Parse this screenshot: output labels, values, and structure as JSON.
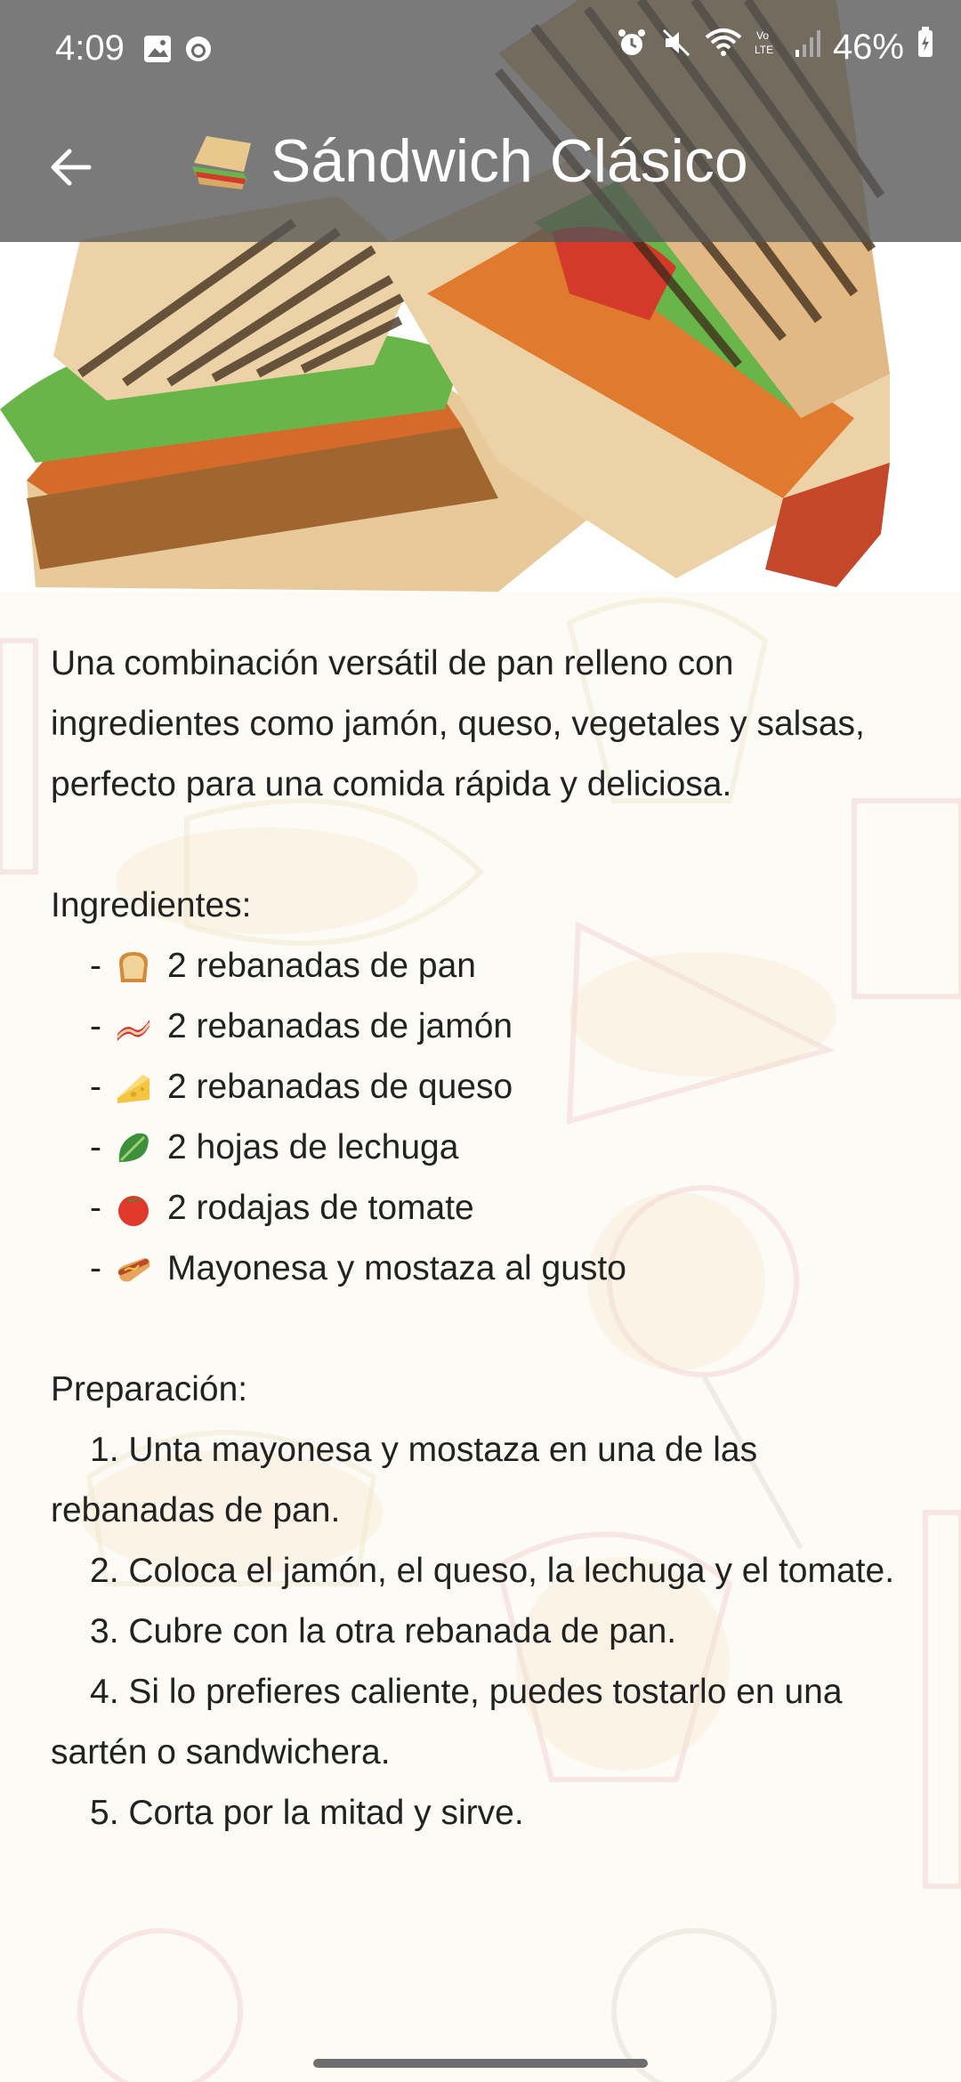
{
  "status_bar": {
    "time": "4:09",
    "battery": "46%",
    "icons": [
      "gallery-icon",
      "sync-icon",
      "alarm-icon",
      "mute-icon",
      "wifi-icon",
      "volte-icon",
      "signal-icon",
      "battery-icon"
    ]
  },
  "toolbar": {
    "back_icon": "arrow-left-icon",
    "title": "Sándwich Clásico",
    "title_icon": "sandwich-icon"
  },
  "colors": {
    "appbar": "#555555",
    "text": "#222222",
    "background": "#fdfbf6"
  },
  "recipe": {
    "description": "Una combinación versátil de pan relleno con ingredientes como jamón, queso, vegetales y salsas, perfecto para una comida rápida y deliciosa.",
    "ingredients_title": "Ingredientes:",
    "ingredients": [
      {
        "icon": "bread-icon",
        "text": "2 rebanadas de pan"
      },
      {
        "icon": "bacon-icon",
        "text": "2 rebanadas de jamón"
      },
      {
        "icon": "cheese-icon",
        "text": "2 rebanadas de queso"
      },
      {
        "icon": "lettuce-icon",
        "text": "2 hojas de lechuga"
      },
      {
        "icon": "tomato-icon",
        "text": "2 rodajas de tomate"
      },
      {
        "icon": "hotdog-icon",
        "text": "Mayonesa y mostaza al gusto"
      }
    ],
    "dash": "-",
    "preparation_title": "Preparación:",
    "steps": [
      "1. Unta mayonesa y mostaza en una de las rebanadas de pan.",
      "2. Coloca el jamón, el queso, la lechuga y el tomate.",
      "3. Cubre con la otra rebanada de pan.",
      "4. Si lo prefieres caliente, puedes tostarlo en una sartén o sandwichera.",
      "5. Corta por la mitad y sirve."
    ]
  }
}
